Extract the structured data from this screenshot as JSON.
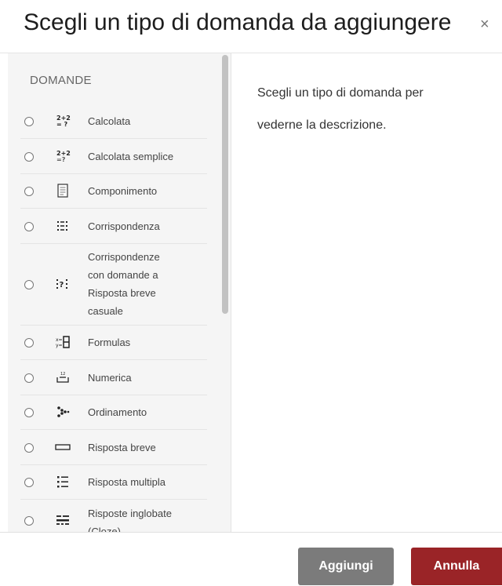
{
  "dialog": {
    "title": "Scegli un tipo di domanda da aggiungere",
    "close_symbol": "×"
  },
  "options": {
    "section_heading": "DOMANDE",
    "items": [
      {
        "label": "Calcolata",
        "icon": "calculated-icon"
      },
      {
        "label": "Calcolata semplice",
        "icon": "calculated-simple-icon"
      },
      {
        "label": "Componimento",
        "icon": "essay-icon"
      },
      {
        "label": "Corrispondenza",
        "icon": "matching-icon"
      },
      {
        "label_lines": [
          "Corrispondenze",
          "con domande a",
          "Risposta breve",
          "casuale"
        ],
        "icon": "random-short-answer-matching-icon"
      },
      {
        "label": "Formulas",
        "icon": "formulas-icon"
      },
      {
        "label": "Numerica",
        "icon": "numerical-icon"
      },
      {
        "label": "Ordinamento",
        "icon": "ordering-icon"
      },
      {
        "label": "Risposta breve",
        "icon": "short-answer-icon"
      },
      {
        "label": "Risposta multipla",
        "icon": "multiple-choice-icon"
      },
      {
        "label_lines": [
          "Risposte inglobate",
          "(Cloze)"
        ],
        "icon": "cloze-icon"
      }
    ]
  },
  "description": {
    "line1": "Scegli un tipo di domanda per",
    "line2": "vederne la descrizione."
  },
  "footer": {
    "add_label": "Aggiungi",
    "cancel_label": "Annulla"
  },
  "colors": {
    "cancel_button": "#9a2427",
    "add_button": "#7b7b7b"
  }
}
